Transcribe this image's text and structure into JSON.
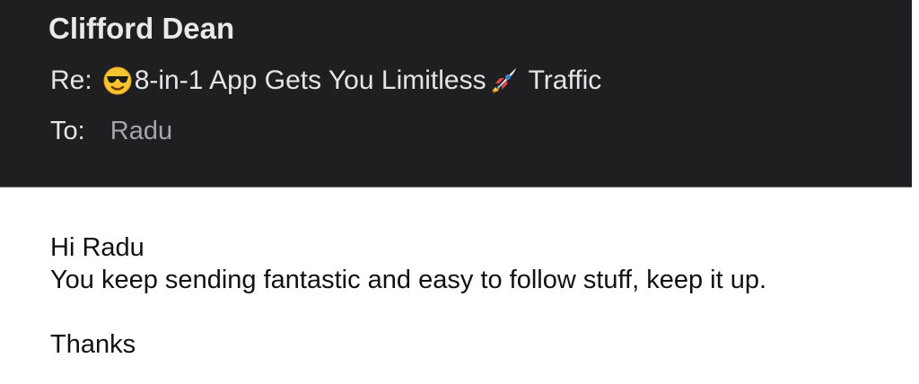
{
  "email": {
    "sender": "Clifford Dean",
    "subject": {
      "prefix": "Re:",
      "emoji_1": "smiling-face-with-sunglasses-icon",
      "text_before": "8-in-1 App Gets You Limitless",
      "emoji_2": "rocket-icon",
      "text_after": "Traffic"
    },
    "to": {
      "label": "To:",
      "value": "Radu"
    },
    "body": {
      "greeting": "Hi Radu",
      "line_1": "You keep sending fantastic and easy to follow stuff, keep it up.",
      "closing": "Thanks"
    }
  },
  "colors": {
    "header_bg": "#1f1f22",
    "header_text": "#e5e5e7",
    "muted_text": "#a6a6aa",
    "body_text": "#111111"
  }
}
